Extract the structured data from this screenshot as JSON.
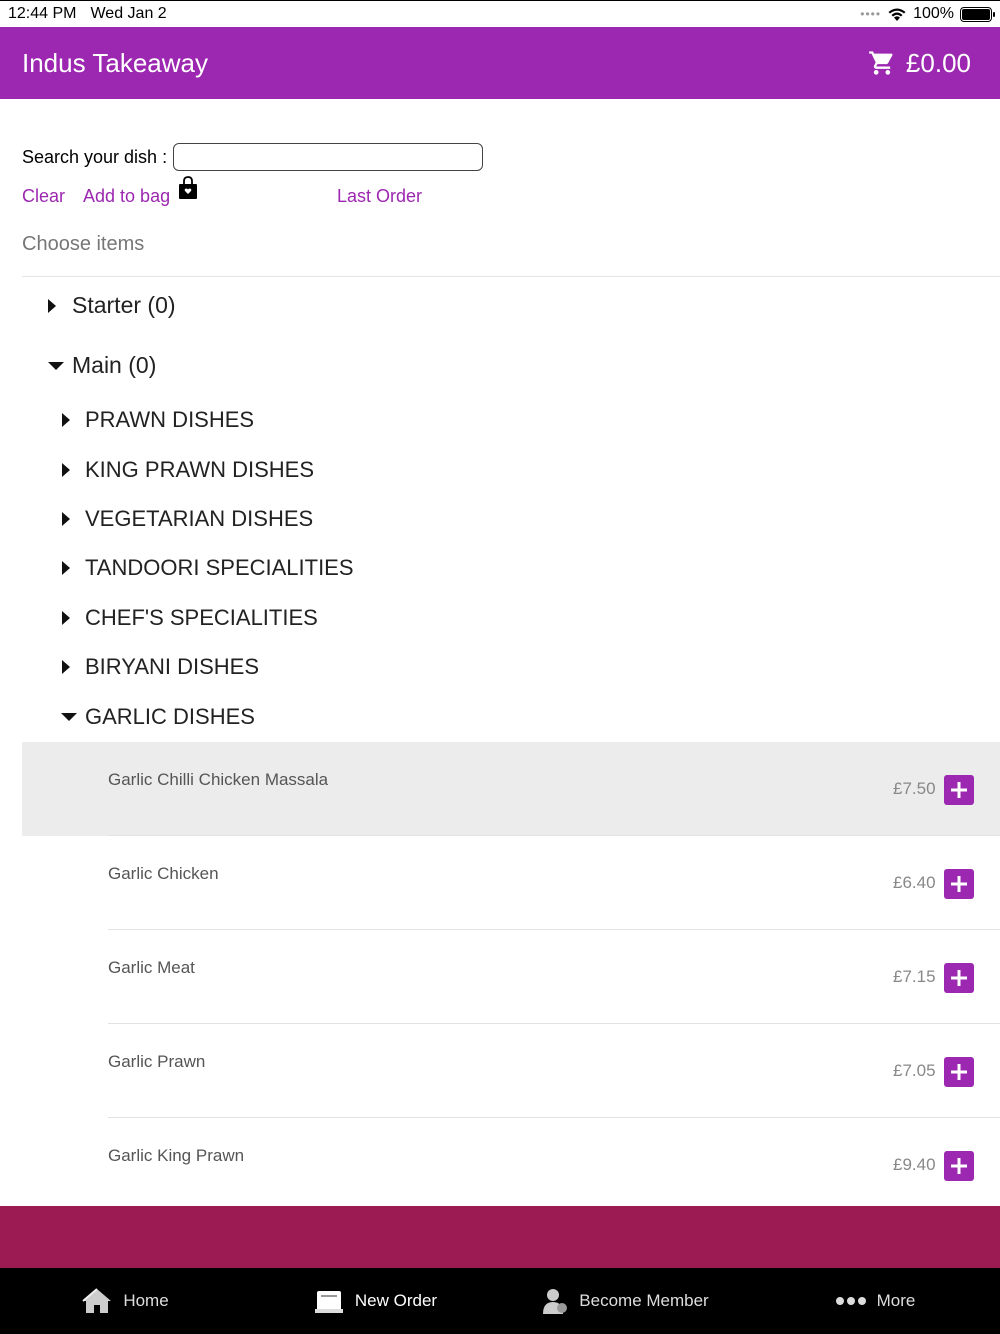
{
  "status_bar": {
    "time": "12:44 PM",
    "date": "Wed Jan 2",
    "battery": "100%"
  },
  "header": {
    "title": "Indus Takeaway",
    "cart_total": "£0.00"
  },
  "search": {
    "label": "Search your dish :",
    "value": "",
    "placeholder": ""
  },
  "links": {
    "clear": "Clear",
    "add_to_bag": "Add to bag",
    "last_order": "Last Order"
  },
  "choose_label": "Choose items",
  "categories": [
    {
      "label": "Starter (0)",
      "expanded": false
    },
    {
      "label": "Main (0)",
      "expanded": true
    }
  ],
  "subcategories": [
    {
      "label": "PRAWN DISHES",
      "expanded": false
    },
    {
      "label": "KING PRAWN DISHES",
      "expanded": false
    },
    {
      "label": "VEGETARIAN DISHES",
      "expanded": false
    },
    {
      "label": "TANDOORI SPECIALITIES",
      "expanded": false
    },
    {
      "label": "CHEF'S SPECIALITIES",
      "expanded": false
    },
    {
      "label": "BIRYANI DISHES",
      "expanded": false
    },
    {
      "label": "GARLIC DISHES",
      "expanded": true
    }
  ],
  "dishes": [
    {
      "name": "Garlic Chilli Chicken Massala",
      "price": "£7.50",
      "highlighted": true
    },
    {
      "name": "Garlic Chicken",
      "price": "£6.40",
      "highlighted": false
    },
    {
      "name": "Garlic Meat",
      "price": "£7.15",
      "highlighted": false
    },
    {
      "name": "Garlic Prawn",
      "price": "£7.05",
      "highlighted": false
    },
    {
      "name": "Garlic King Prawn",
      "price": "£9.40",
      "highlighted": false
    }
  ],
  "tabs": [
    {
      "label": "Home",
      "icon": "home-icon"
    },
    {
      "label": "New Order",
      "icon": "new-order-icon",
      "active": true
    },
    {
      "label": "Become Member",
      "icon": "member-icon"
    },
    {
      "label": "More",
      "icon": "more-icon"
    }
  ],
  "colors": {
    "primary": "#9c27b0",
    "footer_band": "#9c1b52",
    "tab_bar": "#000000"
  }
}
